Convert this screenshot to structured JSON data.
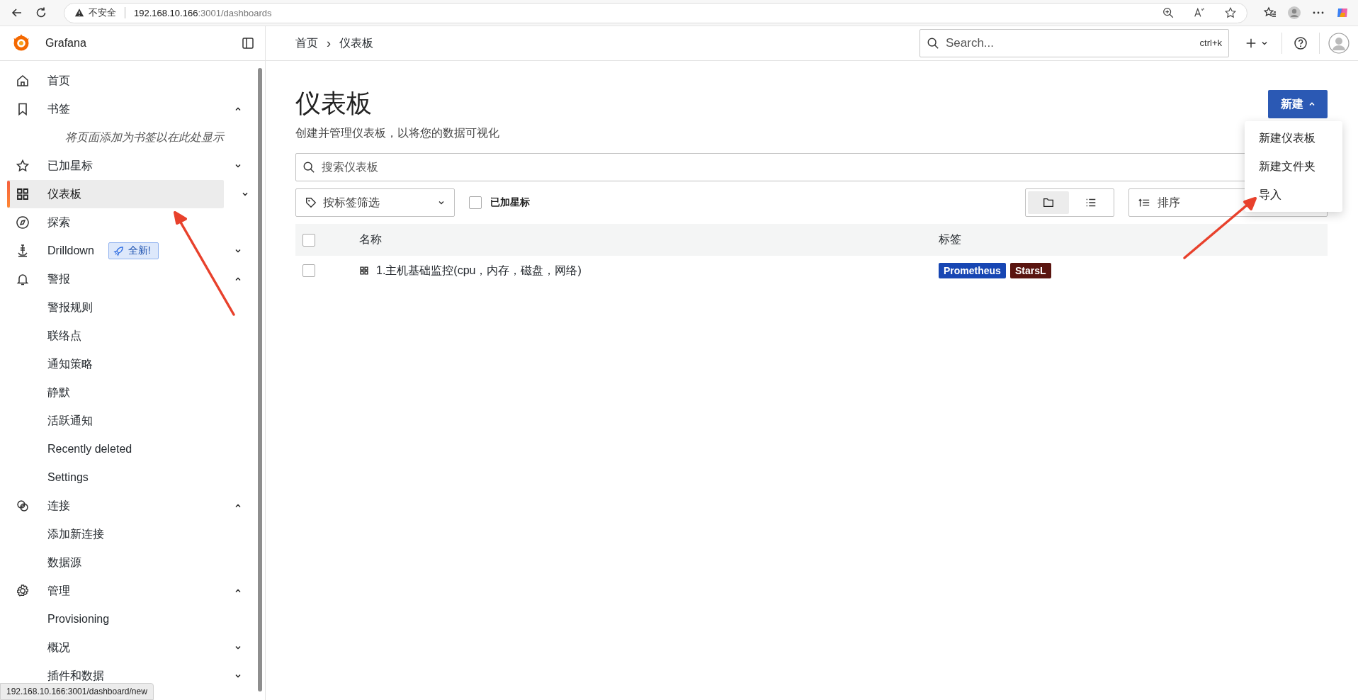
{
  "browser": {
    "security_label": "不安全",
    "url_host": "192.168.10.166",
    "url_rest": ":3001/dashboards"
  },
  "app": {
    "name": "Grafana"
  },
  "breadcrumbs": [
    {
      "label": "首页"
    },
    {
      "label": "仪表板"
    }
  ],
  "breadcrumb_separator": "›",
  "search": {
    "placeholder": "Search...",
    "shortcut": "ctrl+k"
  },
  "nav": [
    {
      "label": "首页",
      "selected": false
    },
    {
      "label": "书签",
      "selected": false,
      "expanded": true,
      "hint": "将页面添加为书签以在此处显示"
    },
    {
      "label": "已加星标",
      "selected": false,
      "expanded": false
    },
    {
      "label": "仪表板",
      "selected": true,
      "expanded": false
    },
    {
      "label": "探索",
      "selected": false
    },
    {
      "label": "Drilldown",
      "selected": false,
      "expanded": false,
      "badge": "全新!"
    },
    {
      "label": "警报",
      "selected": false,
      "expanded": true,
      "children": [
        {
          "label": "警报规则"
        },
        {
          "label": "联络点"
        },
        {
          "label": "通知策略"
        },
        {
          "label": "静默"
        },
        {
          "label": "活跃通知"
        },
        {
          "label": "Recently deleted"
        },
        {
          "label": "Settings"
        }
      ]
    },
    {
      "label": "连接",
      "selected": false,
      "expanded": true,
      "children": [
        {
          "label": "添加新连接"
        },
        {
          "label": "数据源"
        }
      ]
    },
    {
      "label": "管理",
      "selected": false,
      "expanded": true,
      "children": [
        {
          "label": "Provisioning"
        },
        {
          "label": "概况",
          "expanded": false
        },
        {
          "label": "插件和数据",
          "expanded": false
        }
      ]
    }
  ],
  "page": {
    "title": "仪表板",
    "subtitle": "创建并管理仪表板，以将您的数据可视化"
  },
  "new_button": {
    "label": "新建",
    "expanded": true
  },
  "new_menu": [
    {
      "label": "新建仪表板"
    },
    {
      "label": "新建文件夹"
    },
    {
      "label": "导入"
    }
  ],
  "dashboard_search": {
    "placeholder": "搜索仪表板"
  },
  "tag_filter": {
    "placeholder": "按标签筛选"
  },
  "starred_filter": {
    "label": "已加星标",
    "checked": false
  },
  "view_toggle": [
    {
      "kind": "folder",
      "selected": true
    },
    {
      "kind": "list",
      "selected": false
    }
  ],
  "sort": {
    "placeholder": "排序"
  },
  "table": {
    "select_all_checked": false,
    "columns": [
      "名称",
      "标签"
    ],
    "rows": [
      {
        "checked": false,
        "name": "1.主机基础监控(cpu，内存，磁盘，网络)",
        "tags": [
          {
            "label": "Prometheus",
            "color": "#1746b3"
          },
          {
            "label": "StarsL",
            "color": "#5a1510"
          }
        ]
      }
    ]
  },
  "status_url": "192.168.10.166:3001/dashboard/new"
}
